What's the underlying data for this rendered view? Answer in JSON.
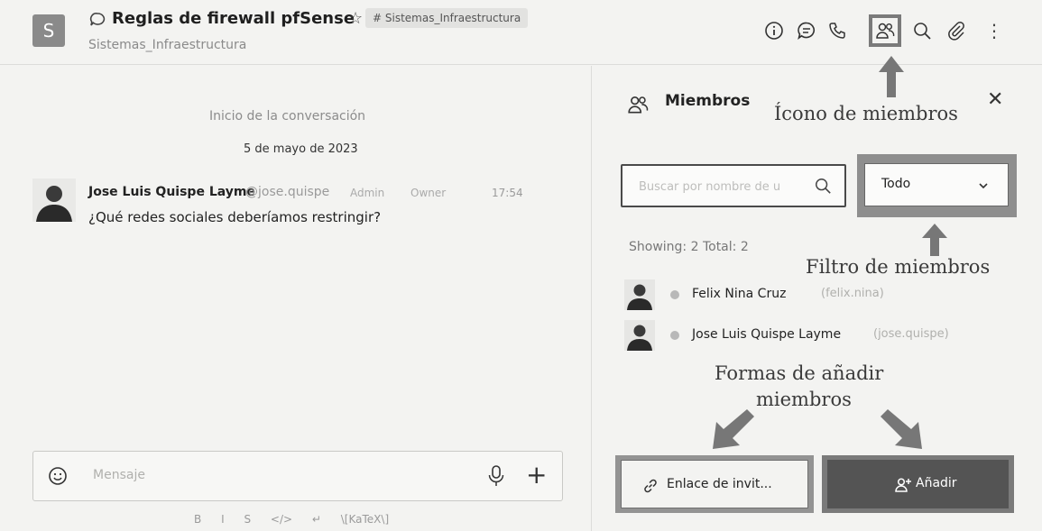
{
  "header": {
    "room_avatar_letter": "S",
    "room_title": "Reglas de firewall pfSense",
    "team_badge": "# Sistemas_Infraestructura",
    "subtitle": "Sistemas_Infraestructura",
    "toolbar_icons": [
      "info-icon",
      "threads-icon",
      "phone-icon",
      "members-icon",
      "search-icon",
      "attachment-icon",
      "kebab-menu-icon"
    ]
  },
  "chat": {
    "conversation_start": "Inicio de la conversación",
    "date_divider": "5 de mayo de 2023",
    "message": {
      "author": "Jose Luis Quispe Layme",
      "handle": "@jose.quispe",
      "roles": [
        "Admin",
        "Owner"
      ],
      "time": "17:54",
      "text": "¿Qué redes sociales deberíamos restringir?"
    },
    "composer": {
      "placeholder": "Mensaje"
    },
    "format_bar": [
      "B",
      "I",
      "S",
      "</>",
      "↵",
      "\\[KaTeX\\]"
    ]
  },
  "members_panel": {
    "title": "Miembros",
    "search_placeholder": "Buscar por nombre de u",
    "filter_value": "Todo",
    "showing_text": "Showing: 2  Total: 2",
    "members": [
      {
        "name": "Felix Nina Cruz",
        "username": "(felix.nina)"
      },
      {
        "name": "Jose Luis Quispe Layme",
        "username": "(jose.quispe)"
      }
    ],
    "invite_label": "Enlace de invit...",
    "add_label": "Añadir"
  },
  "annotations": {
    "members_icon": "Ícono de miembros",
    "members_filter": "Filtro de miembros",
    "add_ways_line1": "Formas de añadir",
    "add_ways_line2": "miembros"
  },
  "colors": {
    "background": "#f3f3f1",
    "highlight_frame": "#7a7a7a",
    "add_button": "#545454"
  }
}
